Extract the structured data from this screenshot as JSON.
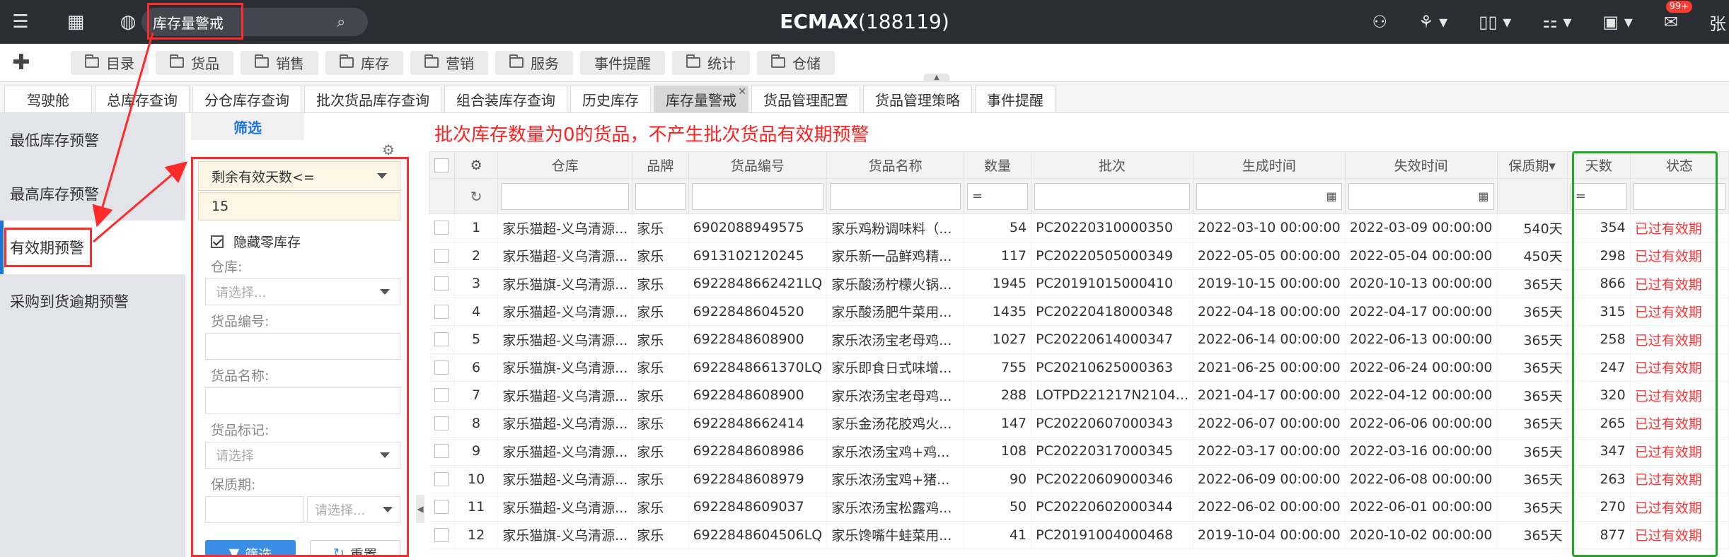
{
  "topbar": {
    "search_value": "库存量警戒",
    "title": "ECMAX",
    "title_suffix": "(188119)",
    "badge": "99+",
    "user_initial": "张"
  },
  "nav": {
    "items": [
      "目录",
      "货品",
      "销售",
      "库存",
      "营销",
      "服务",
      "事件提醒",
      "统计",
      "仓储"
    ]
  },
  "tabs": [
    "驾驶舱",
    "总库存查询",
    "分仓库存查询",
    "批次货品库存查询",
    "组合装库存查询",
    "历史库存",
    "库存量警戒",
    "货品管理配置",
    "货品管理策略",
    "事件提醒"
  ],
  "active_tab_index": 6,
  "leftmenu": [
    "最低库存预警",
    "最高库存预警",
    "有效期预警",
    "采购到货逾期预警"
  ],
  "filter": {
    "tab_label": "筛选",
    "condition_select": "剩余有效天数<=",
    "condition_value": "15",
    "hide_zero_label": "隐藏零库存",
    "warehouse_label": "仓库:",
    "warehouse_placeholder": "请选择...",
    "goods_no_label": "货品编号:",
    "goods_name_label": "货品名称:",
    "goods_tag_label": "货品标记:",
    "goods_tag_placeholder": "请选择",
    "shelf_life_label": "保质期:",
    "shelf_life_placeholder": "请选择...",
    "filter_button": "筛选",
    "reset_button": "重置"
  },
  "grid": {
    "warning_text": "批次库存数量为0的货品，不产生批次货品有效期预警",
    "headers": [
      "仓库",
      "品牌",
      "货品编号",
      "货品名称",
      "数量",
      "批次",
      "生成时间",
      "失效时间",
      "保质期",
      "天数",
      "状态"
    ],
    "eq_symbol": "=",
    "rows": [
      {
        "n": "1",
        "wh": "家乐猫超-义乌清源...",
        "brand": "家乐",
        "code": "6902088949575",
        "name": "家乐鸡粉调味料（...",
        "qty": "54",
        "batch": "PC20220310000350",
        "created": "2022-03-10 00:00:00",
        "expire": "2022-03-09 00:00:00",
        "shelf": "540天",
        "days": "354",
        "status": "已过有效期"
      },
      {
        "n": "2",
        "wh": "家乐猫超-义乌清源...",
        "brand": "家乐",
        "code": "6913102120245",
        "name": "家乐新一品鲜鸡精...",
        "qty": "117",
        "batch": "PC20220505000349",
        "created": "2022-05-05 00:00:00",
        "expire": "2022-05-04 00:00:00",
        "shelf": "450天",
        "days": "298",
        "status": "已过有效期"
      },
      {
        "n": "3",
        "wh": "家乐猫旗-义乌清源...",
        "brand": "家乐",
        "code": "6922848662421LQ",
        "name": "家乐酸汤柠檬火锅...",
        "qty": "1945",
        "batch": "PC20191015000410",
        "created": "2019-10-15 00:00:00",
        "expire": "2020-10-13 00:00:00",
        "shelf": "365天",
        "days": "866",
        "status": "已过有效期"
      },
      {
        "n": "4",
        "wh": "家乐猫超-义乌清源...",
        "brand": "家乐",
        "code": "6922848604520",
        "name": "家乐酸汤肥牛菜用...",
        "qty": "1435",
        "batch": "PC20220418000348",
        "created": "2022-04-18 00:00:00",
        "expire": "2022-04-17 00:00:00",
        "shelf": "365天",
        "days": "315",
        "status": "已过有效期"
      },
      {
        "n": "5",
        "wh": "家乐猫超-义乌清源...",
        "brand": "家乐",
        "code": "6922848608900",
        "name": "家乐浓汤宝老母鸡...",
        "qty": "1027",
        "batch": "PC20220614000347",
        "created": "2022-06-14 00:00:00",
        "expire": "2022-06-13 00:00:00",
        "shelf": "365天",
        "days": "258",
        "status": "已过有效期"
      },
      {
        "n": "6",
        "wh": "家乐猫旗-义乌清源...",
        "brand": "家乐",
        "code": "6922848661370LQ",
        "name": "家乐即食日式味增...",
        "qty": "755",
        "batch": "PC20210625000363",
        "created": "2021-06-25 00:00:00",
        "expire": "2022-06-24 00:00:00",
        "shelf": "365天",
        "days": "247",
        "status": "已过有效期"
      },
      {
        "n": "7",
        "wh": "家乐猫超-义乌清源...",
        "brand": "家乐",
        "code": "6922848608900",
        "name": "家乐浓汤宝老母鸡...",
        "qty": "288",
        "batch": "LOTPD221217N2104...",
        "created": "2021-04-17 00:00:00",
        "expire": "2022-04-12 00:00:00",
        "shelf": "365天",
        "days": "320",
        "status": "已过有效期"
      },
      {
        "n": "8",
        "wh": "家乐猫超-义乌清源...",
        "brand": "家乐",
        "code": "6922848662414",
        "name": "家乐金汤花胶鸡火...",
        "qty": "147",
        "batch": "PC20220607000343",
        "created": "2022-06-07 00:00:00",
        "expire": "2022-06-06 00:00:00",
        "shelf": "365天",
        "days": "265",
        "status": "已过有效期"
      },
      {
        "n": "9",
        "wh": "家乐猫超-义乌清源...",
        "brand": "家乐",
        "code": "6922848608986",
        "name": "家乐浓汤宝鸡+鸡...",
        "qty": "108",
        "batch": "PC20220317000345",
        "created": "2022-03-17 00:00:00",
        "expire": "2022-03-16 00:00:00",
        "shelf": "365天",
        "days": "347",
        "status": "已过有效期"
      },
      {
        "n": "10",
        "wh": "家乐猫超-义乌清源...",
        "brand": "家乐",
        "code": "6922848608979",
        "name": "家乐浓汤宝鸡+猪...",
        "qty": "90",
        "batch": "PC20220609000346",
        "created": "2022-06-09 00:00:00",
        "expire": "2022-06-08 00:00:00",
        "shelf": "365天",
        "days": "263",
        "status": "已过有效期"
      },
      {
        "n": "11",
        "wh": "家乐猫超-义乌清源...",
        "brand": "家乐",
        "code": "6922848609037",
        "name": "家乐浓汤宝松露鸡...",
        "qty": "50",
        "batch": "PC20220602000344",
        "created": "2022-06-02 00:00:00",
        "expire": "2022-06-01 00:00:00",
        "shelf": "365天",
        "days": "270",
        "status": "已过有效期"
      },
      {
        "n": "12",
        "wh": "家乐猫旗-义乌清源...",
        "brand": "家乐",
        "code": "6922848604506LQ",
        "name": "家乐馋嘴牛蛙菜用...",
        "qty": "41",
        "batch": "PC20191004000468",
        "created": "2019-10-04 00:00:00",
        "expire": "2020-10-02 00:00:00",
        "shelf": "365天",
        "days": "877",
        "status": "已过有效期"
      }
    ]
  },
  "colors": {
    "annotation_red": "#ff2a2a",
    "annotation_green": "#22aa22",
    "expired_red": "#ff3333",
    "accent_blue": "#1e73d6"
  }
}
